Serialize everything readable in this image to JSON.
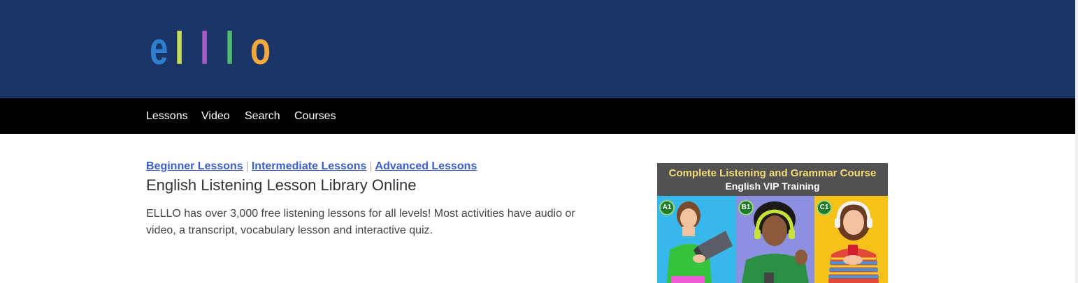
{
  "logo": {
    "letters": [
      "e",
      "l",
      "l",
      "l",
      "o"
    ],
    "colors": [
      "#2f7fd0",
      "#c5dc59",
      "#a55cc4",
      "#4fba6d",
      "#f3a93b"
    ]
  },
  "colors": {
    "header_bg": "#1b3567",
    "nav_bg": "#000000",
    "link": "#3a5fcd"
  },
  "nav": {
    "items": [
      {
        "label": "Lessons"
      },
      {
        "label": "Video"
      },
      {
        "label": "Search"
      },
      {
        "label": "Courses"
      }
    ]
  },
  "levels": {
    "beginner": "Beginner Lessons",
    "intermediate": "Intermediate Lessons",
    "advanced": "Advanced Lessons",
    "separator": "|"
  },
  "main": {
    "title": "English Listening Lesson Library Online",
    "intro": "ELLLO has over 3,000 free listening lessons for all levels! Most activities have audio or video, a transcript, vocabulary lesson and interactive quiz."
  },
  "ad": {
    "title": "Complete Listening and Grammar Course",
    "subtitle": "English VIP Training",
    "levels": [
      "A1",
      "B1",
      "C1"
    ]
  }
}
